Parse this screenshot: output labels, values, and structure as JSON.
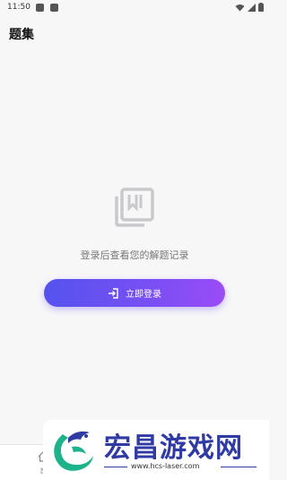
{
  "status_bar": {
    "time": "11:50"
  },
  "header": {
    "title": "题集"
  },
  "empty_state": {
    "icon": "bookmark-book-icon",
    "message": "登录后查看您的解题记录"
  },
  "login_button": {
    "icon": "login-arrow-icon",
    "label": "立即登录"
  },
  "bottom_nav": {
    "home_label": "首"
  },
  "watermark": {
    "brand": "宏昌游戏网",
    "url": "www.hcs-laser.com"
  },
  "colors": {
    "button_start": "#5552ee",
    "button_end": "#9b4cf6",
    "brand_blue": "#2f3aa3"
  }
}
